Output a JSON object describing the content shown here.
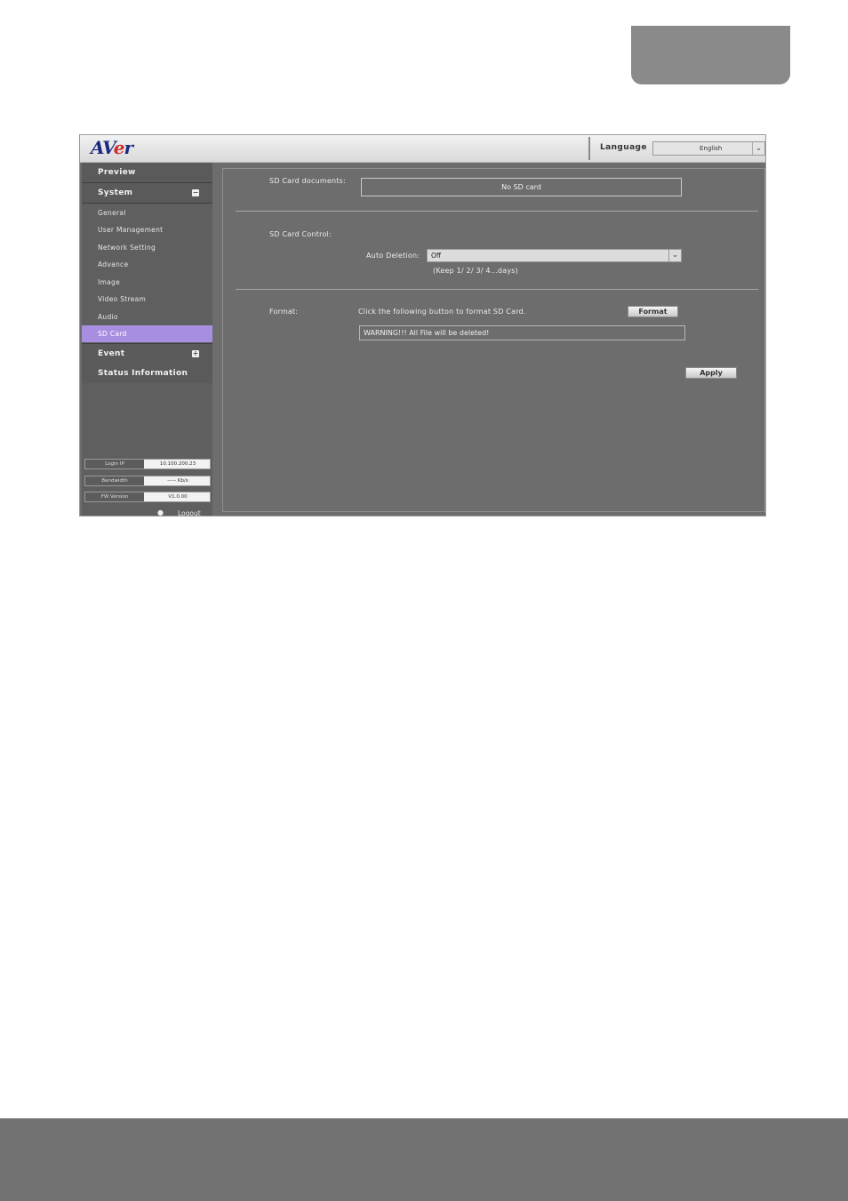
{
  "header": {
    "logo_text": "AVer",
    "language_label": "Language",
    "language_value": "English"
  },
  "sidebar": {
    "preview": "Preview",
    "system": "System",
    "system_toggle": "−",
    "items": [
      {
        "label": "General"
      },
      {
        "label": "User Management"
      },
      {
        "label": "Network Setting"
      },
      {
        "label": "Advance"
      },
      {
        "label": "Image"
      },
      {
        "label": "Video Stream"
      },
      {
        "label": "Audio"
      },
      {
        "label": "SD Card"
      }
    ],
    "active_item": "SD Card",
    "event": "Event",
    "event_toggle": "+",
    "status": "Status Information",
    "info": {
      "login_ip_label": "Login IP",
      "login_ip_value": "10.100.200.23",
      "bandwidth_label": "Bandwidth",
      "bandwidth_value": "----- Kb/s",
      "fw_label": "FW Version",
      "fw_value": "V1.0.00"
    },
    "logout": "Logout"
  },
  "content": {
    "sd_documents_label": "SD Card documents:",
    "sd_documents_value": "No SD card",
    "sd_control_label": "SD Card Control:",
    "auto_deletion_label": "Auto Deletion:",
    "auto_deletion_value": "Off",
    "auto_deletion_hint": "(Keep 1/ 2/ 3/ 4...days)",
    "format_label": "Format:",
    "format_desc": "Click the following button to format SD Card.",
    "format_button": "Format",
    "warning": "WARNING!!! All File will be deleted!",
    "apply_button": "Apply"
  },
  "colors": {
    "active_item": "#a88ee0",
    "panel": "#6d6d6d",
    "sidebar": "#5f5f5f"
  }
}
